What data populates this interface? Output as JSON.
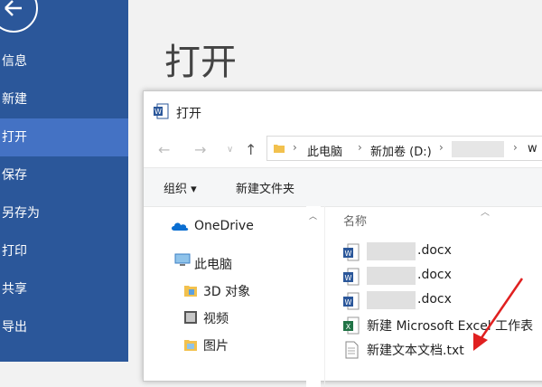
{
  "backstage": {
    "title": "打开",
    "menu": [
      {
        "label": "信息"
      },
      {
        "label": "新建"
      },
      {
        "label": "打开"
      },
      {
        "label": "保存"
      },
      {
        "label": "另存为"
      },
      {
        "label": "打印"
      },
      {
        "label": "共享"
      },
      {
        "label": "导出"
      }
    ],
    "accent": "#2b579a",
    "active_color": "#4472c4"
  },
  "dialog": {
    "title": "打开",
    "address": {
      "crumbs": [
        "此电脑",
        "新加卷 (D:)",
        "w"
      ]
    },
    "toolbar": {
      "organize": "组织 ▾",
      "new_folder": "新建文件夹"
    },
    "nav": {
      "items": [
        {
          "label": "OneDrive",
          "icon": "onedrive-icon"
        },
        {
          "label": "此电脑",
          "icon": "computer-icon"
        },
        {
          "label": "3D 对象",
          "icon": "3d-objects-icon"
        },
        {
          "label": "视频",
          "icon": "video-icon"
        },
        {
          "label": "图片",
          "icon": "pictures-icon"
        }
      ]
    },
    "files": {
      "column": "名称",
      "rows": [
        {
          "name": ".docx",
          "type": "word"
        },
        {
          "name": ".docx",
          "type": "word"
        },
        {
          "name": ".docx",
          "type": "word"
        },
        {
          "name": "新建 Microsoft Excel 工作表",
          "type": "excel"
        },
        {
          "name": "新建文本文档.txt",
          "type": "text"
        }
      ]
    }
  }
}
